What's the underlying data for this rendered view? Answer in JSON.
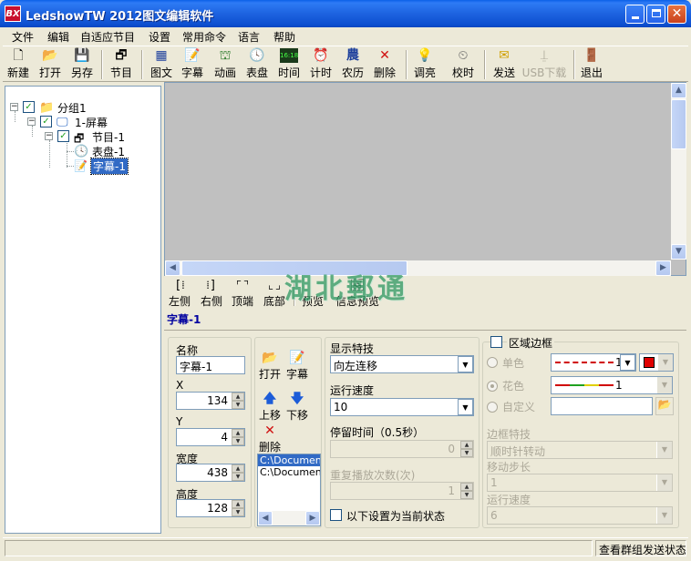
{
  "window": {
    "title": "LedshowTW 2012图文编辑软件",
    "logo": "BX"
  },
  "menu": [
    "文件",
    "编辑",
    "自适应节目",
    "设置",
    "常用命令",
    "语言",
    "帮助"
  ],
  "toolbar": {
    "new": "新建",
    "open": "打开",
    "save_as": "另存",
    "program": "节目",
    "image_text": "图文",
    "subtitle": "字幕",
    "animation": "动画",
    "clock": "表盘",
    "time": "时间",
    "timer": "计时",
    "lunar": "农历",
    "delete": "删除",
    "brightness": "调亮",
    "calibrate": "校时",
    "send": "发送",
    "usb_download": "USB下载",
    "exit": "退出",
    "time_icon_text": "16:18",
    "lunar_icon_text": "農"
  },
  "tree": {
    "group": "分组1",
    "screen": "1-屏幕",
    "program": "节目-1",
    "clock": "表盘-1",
    "subtitle": "字幕-1"
  },
  "align_bar": {
    "left": "左侧",
    "right": "右侧",
    "top": "顶端",
    "bottom": "底部",
    "preview": "预览",
    "info_preview": "信息预览"
  },
  "watermark": "湖北郵通",
  "current_item": "字幕-1",
  "props": {
    "name_label": "名称",
    "name_value": "字幕-1",
    "x_label": "X",
    "x_value": "134",
    "y_label": "Y",
    "y_value": "4",
    "width_label": "宽度",
    "width_value": "438",
    "height_label": "高度",
    "height_value": "128"
  },
  "file_ops": {
    "open": "打开",
    "subtitle": "字幕",
    "move_up": "上移",
    "move_down": "下移",
    "delete": "删除",
    "files": [
      "C:\\Documents",
      "C:\\Documents"
    ]
  },
  "effects": {
    "display_effect_label": "显示特技",
    "display_effect_value": "向左连移",
    "speed_label": "运行速度",
    "speed_value": "10",
    "stay_label": "停留时间（0.5秒）",
    "stay_value": "0",
    "repeat_label": "重复播放次数(次)",
    "repeat_value": "1",
    "set_current_label": "以下设置为当前状态"
  },
  "border": {
    "area_border_label": "区域边框",
    "single_color": "单色",
    "single_value": "1",
    "flower_color": "花色",
    "flower_value": "1",
    "custom": "自定义",
    "border_effect_label": "边框特技",
    "border_effect_value": "顺时针转动",
    "move_step_label": "移动步长",
    "move_step_value": "1",
    "run_speed_label": "运行速度",
    "run_speed_value": "6",
    "color_swatch": "#e00000"
  },
  "status": {
    "right_text": "查看群组发送状态"
  }
}
